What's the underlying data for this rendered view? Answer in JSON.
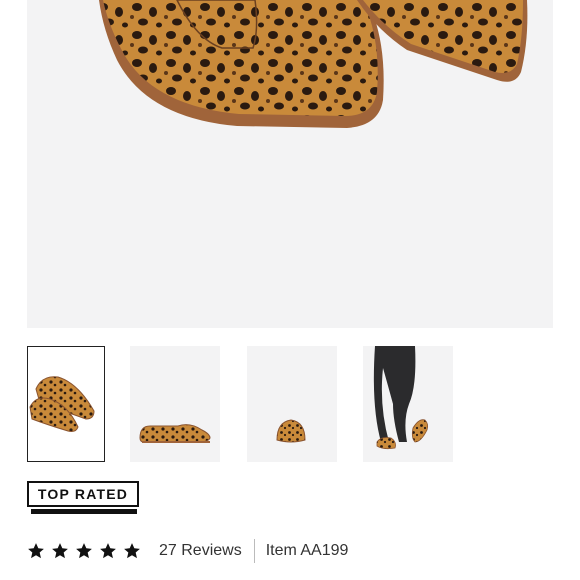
{
  "gallery": {
    "hero_alt": "leopard print calf hair loafers",
    "thumbnails": [
      {
        "name": "thumbnail-pair-angled",
        "selected": true
      },
      {
        "name": "thumbnail-side-view",
        "selected": false
      },
      {
        "name": "thumbnail-front-view",
        "selected": false
      },
      {
        "name": "thumbnail-on-model",
        "selected": false
      }
    ]
  },
  "badge": {
    "label": "TOP RATED"
  },
  "rating": {
    "stars": 5,
    "reviews_label": "27 Reviews",
    "item_label": "Item AA199"
  },
  "colors": {
    "leopard_base": "#c98a3a",
    "leopard_spot": "#2a1a10",
    "sole": "#a0643a",
    "background": "#f3f3f4",
    "text": "#333333"
  }
}
